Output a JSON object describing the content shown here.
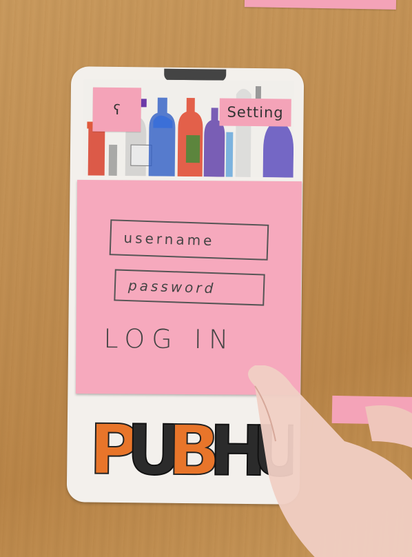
{
  "screen": {
    "top_bar": {
      "back_label": "ʕ",
      "settings_label": "Setting"
    },
    "login": {
      "username_placeholder": "username",
      "password_placeholder": "password",
      "login_label": "LOG IN"
    },
    "branding": {
      "logo_text": "PUBHUB"
    }
  },
  "colors": {
    "sticky_note": "#f6a9bd",
    "paper": "#f3f0ec",
    "ink": "#444444",
    "logo_orange": "#e8752a",
    "logo_black": "#2b2b2b",
    "table": "#c08e52"
  },
  "icons": {
    "back": "back-arrow-icon",
    "bottles": "bottle-shelf-illustration"
  }
}
